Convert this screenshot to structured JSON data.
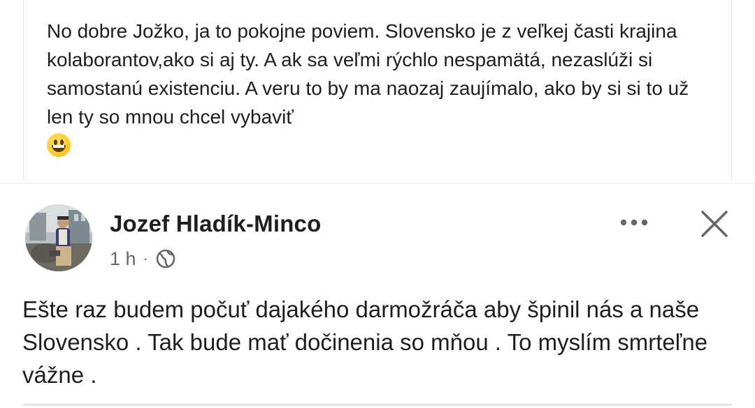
{
  "comment": {
    "text": "No dobre Jožko, ja to pokojne poviem. Slovensko je z veľkej časti krajina kolaborantov,ako si aj ty. A ak sa veľmi rýchlo nespamätá, nezaslúži si samostanú existenciu. A veru to by ma naozaj zaujímalo, ako by si si to už len ty so mnou chcel vybaviť",
    "emoji": "grinning-face"
  },
  "post": {
    "author": "Jozef Hladík-Minco",
    "time": "1 h",
    "separator": "·",
    "audience_icon": "globe-icon",
    "more_icon": "more-options-icon",
    "close_icon": "close-icon",
    "text": "Ešte raz budem počuť dajakého darmožráča aby špinil nás a naše Slovensko . Tak bude mať dočinenia so mňou . To myslím smrteľne vážne ."
  },
  "colors": {
    "text": "#1c1e21",
    "secondary_text": "#65676b",
    "divider": "#e4e6eb"
  }
}
